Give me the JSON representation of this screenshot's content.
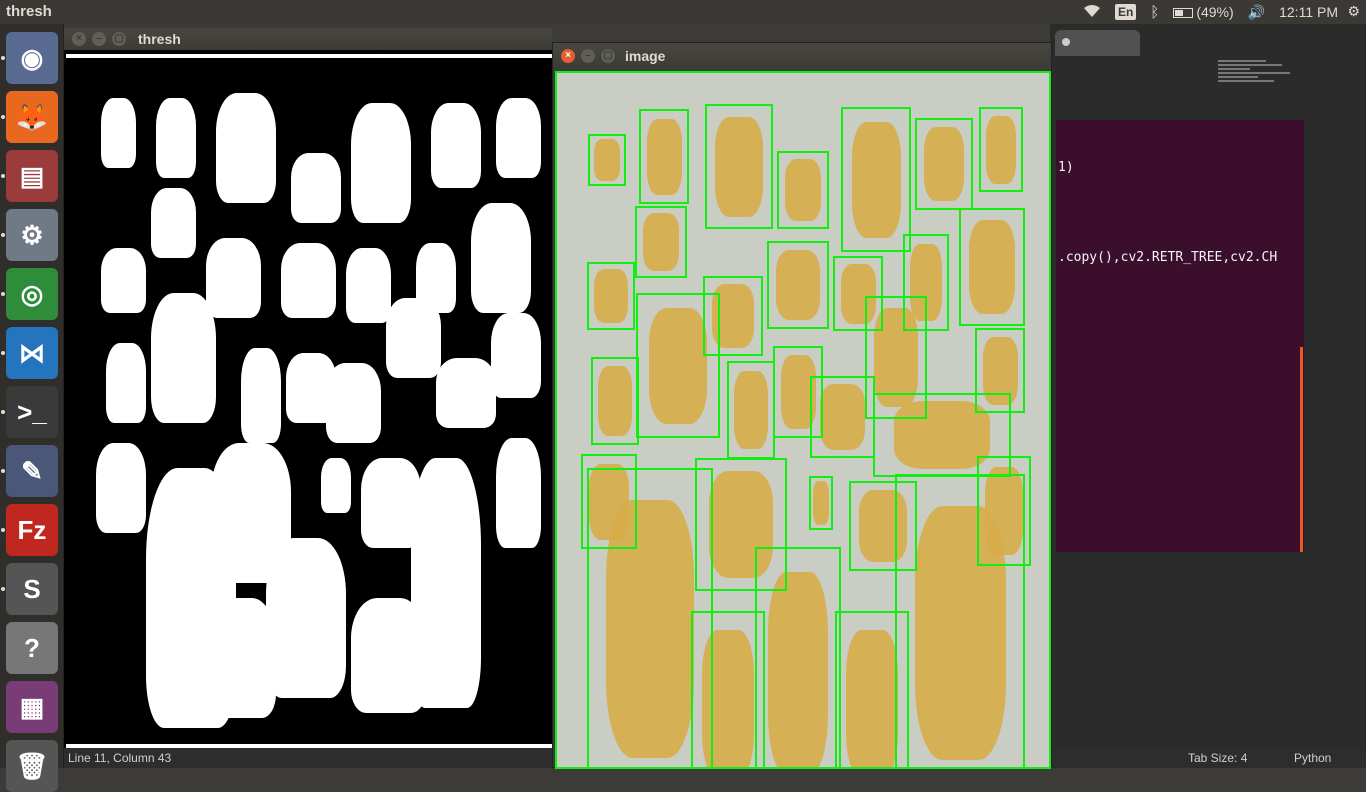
{
  "top_panel": {
    "app_title": "thresh",
    "keyboard": "En",
    "battery_text": "(49%)",
    "battery_level": 0.49,
    "clock": "12:11 PM"
  },
  "launcher": {
    "items": [
      {
        "name": "ubuntu-dash-icon",
        "color": "#5a6b92",
        "glyph": "◉"
      },
      {
        "name": "firefox-icon",
        "color": "#e8681f",
        "glyph": "🦊"
      },
      {
        "name": "files-icon",
        "color": "#9c3b3b",
        "glyph": "▤"
      },
      {
        "name": "system-settings-icon",
        "color": "#6f7a86",
        "glyph": "⚙"
      },
      {
        "name": "chrome-icon",
        "color": "#2f8c3a",
        "glyph": "◎"
      },
      {
        "name": "vscode-icon",
        "color": "#2474be",
        "glyph": "⋈"
      },
      {
        "name": "terminal-icon",
        "color": "#3a3a3a",
        "glyph": ">_"
      },
      {
        "name": "inkscape-icon",
        "color": "#4a5778",
        "glyph": "✎"
      },
      {
        "name": "filezilla-icon",
        "color": "#c0271f",
        "glyph": "Fz"
      },
      {
        "name": "sublime-text-icon",
        "color": "#555",
        "glyph": "S"
      },
      {
        "name": "help-icon",
        "color": "#777",
        "glyph": "?"
      },
      {
        "name": "workspace-switcher-icon",
        "color": "#7a3c76",
        "glyph": "▦"
      },
      {
        "name": "trash-icon",
        "color": "#555",
        "glyph": "🗑"
      }
    ]
  },
  "thresh_window": {
    "title": "thresh"
  },
  "image_window": {
    "title": "image"
  },
  "editor": {
    "code_lines": [
      "1)",
      ".copy(),cv2.RETR_TREE,cv2.CH"
    ]
  },
  "status_bar": {
    "position": "Line 11, Column 43",
    "tab_size": "Tab Size: 4",
    "syntax": "Python"
  }
}
